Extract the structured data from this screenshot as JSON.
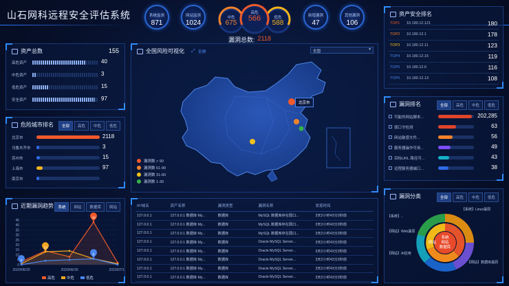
{
  "app_title": "山石网科远程安全评估系统",
  "header_stats": [
    {
      "label": "系统监测",
      "value": "871"
    },
    {
      "label": "网站监测",
      "value": "1024"
    },
    {
      "label": "新增漏洞",
      "value": "47"
    },
    {
      "label": "其他漏洞",
      "value": "106"
    }
  ],
  "severity_gauge": {
    "high_label": "高危",
    "high_value": "566",
    "mid_label": "中危",
    "mid_value": "675",
    "low_label": "低危",
    "low_value": "588"
  },
  "vuln_total": {
    "label": "漏洞总数:",
    "value": "2118"
  },
  "asset_total": {
    "title": "资产总数",
    "total": "155",
    "rows": [
      {
        "label": "高危资产",
        "value": "40",
        "fraction": 0.8
      },
      {
        "label": "中危资产",
        "value": "3",
        "fraction": 0.05
      },
      {
        "label": "低危资产",
        "value": "15",
        "fraction": 0.25
      },
      {
        "label": "安全资产",
        "value": "97",
        "fraction": 0.95
      }
    ]
  },
  "city_rank": {
    "title": "危险城市排名",
    "tabs": [
      "全部",
      "高危",
      "中危",
      "低危"
    ],
    "rows": [
      {
        "label": "北京市",
        "value": "2118",
        "fraction": 1.0,
        "color": "#f15a2b"
      },
      {
        "label": "乌鲁木齐市",
        "value": "3",
        "fraction": 0.02,
        "color": "#2e6be6"
      },
      {
        "label": "苏州市",
        "value": "15",
        "fraction": 0.05,
        "color": "#2e6be6"
      },
      {
        "label": "上海市",
        "value": "97",
        "fraction": 0.1,
        "color": "#f4b41a"
      },
      {
        "label": "南京市",
        "value": "",
        "fraction": 0.0,
        "color": "#2e6be6"
      }
    ]
  },
  "trend": {
    "title": "近期漏洞趋势",
    "tabs": [
      "系统",
      "网站",
      "数据库",
      "网站"
    ],
    "legend": [
      {
        "label": "高危",
        "color": "#f15a2b"
      },
      {
        "label": "中危",
        "color": "#f5a623"
      },
      {
        "label": "低危",
        "color": "#4a86f0"
      }
    ]
  },
  "chart_data": {
    "type": "line",
    "x": [
      "2020/06/20",
      "2020/06/25",
      "2020/06/30",
      "2020/07/05",
      "2020/07/10"
    ],
    "xticks": [
      "2020/06/20",
      "2020/06/30",
      "2020/07/10"
    ],
    "ylim": [
      0,
      50
    ],
    "yticks": [
      "0",
      "5",
      "10",
      "15",
      "20",
      "25",
      "30",
      "35",
      "40",
      "45"
    ],
    "series": [
      {
        "name": "高危",
        "color": "#f15a2b",
        "values": [
          3,
          14,
          8,
          43,
          2
        ]
      },
      {
        "name": "中危",
        "color": "#f5a623",
        "values": [
          1,
          13,
          14,
          6,
          1
        ]
      },
      {
        "name": "低危",
        "color": "#4a86f0",
        "values": [
          0,
          4,
          5,
          6,
          0
        ]
      }
    ],
    "labels": [
      {
        "series": 0,
        "index": 3,
        "text": "43"
      },
      {
        "series": 1,
        "index": 1,
        "text": "13"
      },
      {
        "series": 2,
        "index": 0,
        "text": "3"
      },
      {
        "series": 2,
        "index": 3,
        "text": "6"
      }
    ]
  },
  "map": {
    "title": "全国风险可视化",
    "toggle": "全屏",
    "region_select": "全国",
    "popup_city": "北京市",
    "legend": [
      {
        "label": "漏洞数 > 90",
        "color": "#f15a2b"
      },
      {
        "label": "漏洞数 61-90",
        "color": "#f5832a"
      },
      {
        "label": "漏洞数 31-60",
        "color": "#f4c21a"
      },
      {
        "label": "漏洞数 1-30",
        "color": "#35b34a"
      }
    ]
  },
  "vuln_table": {
    "columns": [
      "IP/域名",
      "资产名称",
      "漏洞类型",
      "漏洞名称",
      "发现时间"
    ],
    "rows": [
      [
        "127.0.0.1",
        "127.0.0.1 数据库 My...",
        "数据库",
        "MySQL 数据库存在弱口...",
        "3天2小时43分2秒前"
      ],
      [
        "127.0.0.1",
        "127.0.0.1 数据库 My...",
        "数据库",
        "MySQL 数据库存在弱口...",
        "3天2小时43分2秒前"
      ],
      [
        "127.0.0.1",
        "127.0.0.1 数据库 My...",
        "数据库",
        "MySQL 数据库存在弱口...",
        "3天2小时43分2秒前"
      ],
      [
        "127.0.0.1",
        "127.0.0.1 数据库 My...",
        "数据库",
        "Oracle MySQL Server...",
        "3天2小时43分2秒前"
      ],
      [
        "127.0.0.1",
        "127.0.0.1 数据库 My...",
        "数据库",
        "Oracle MySQL Server...",
        "3天2小时43分2秒前"
      ],
      [
        "127.0.0.1",
        "127.0.0.1 数据库 My...",
        "数据库",
        "Oracle MySQL Server...",
        "3天2小时43分2秒前"
      ],
      [
        "127.0.0.1",
        "127.0.0.1 数据库 My...",
        "数据库",
        "Oracle MySQL Server...",
        "3天2小时43分2秒前"
      ],
      [
        "127.0.0.1",
        "127.0.0.1 数据库 My...",
        "数据库",
        "Oracle MySQL Server...",
        "3天2小时43分2秒前"
      ]
    ]
  },
  "asset_rank": {
    "title": "资产安全排名",
    "rows": [
      {
        "rank": "TOP1",
        "ip": "10.180.12.121",
        "value": "180",
        "color": "#f15a2b"
      },
      {
        "rank": "TOP2",
        "ip": "10.180.12.1",
        "value": "178",
        "color": "#f5832a"
      },
      {
        "rank": "TOP3",
        "ip": "10.180.12.11",
        "value": "123",
        "color": "#f4c21a"
      },
      {
        "rank": "TOP4",
        "ip": "10.180.12.15",
        "value": "119",
        "color": "#4a86f0"
      },
      {
        "rank": "TOP5",
        "ip": "10.180.12.6",
        "value": "116",
        "color": "#4a86f0"
      },
      {
        "rank": "TOP6",
        "ip": "10.180.12.13",
        "value": "108",
        "color": "#4a86f0"
      }
    ]
  },
  "vuln_rank": {
    "title": "漏洞排名",
    "tabs": [
      "全部",
      "高危",
      "中危",
      "低危"
    ],
    "rows": [
      {
        "label": "可能的网站脚本...",
        "value": "202,285",
        "fraction": 0.95,
        "color": "#e0442a"
      },
      {
        "label": "弱口令检测",
        "value": "63",
        "fraction": 0.5,
        "color": "#e0442a"
      },
      {
        "label": "网站敏感文件...",
        "value": "56",
        "fraction": 0.4,
        "color": "#f5832a"
      },
      {
        "label": "服务器操作可用...",
        "value": "49",
        "fraction": 0.35,
        "color": "#7c4dff"
      },
      {
        "label": "目标URL 路径可...",
        "value": "43",
        "fraction": 0.3,
        "color": "#13b0c9"
      },
      {
        "label": "远程服务器端口...",
        "value": "38",
        "fraction": 0.28,
        "color": "#2e6be6"
      }
    ]
  },
  "vuln_category": {
    "title": "漏洞分类",
    "tabs": [
      "全部",
      "高危",
      "中危",
      "低危"
    ],
    "center": [
      "系统",
      "网站",
      "数据库"
    ],
    "inner_left": "网站",
    "outer_labels": [
      "【系统】Linux漏洞",
      "【系统】..",
      "【网站】Web漏洞",
      "【网站】AI应用",
      "【网站】数据库漏洞"
    ]
  }
}
